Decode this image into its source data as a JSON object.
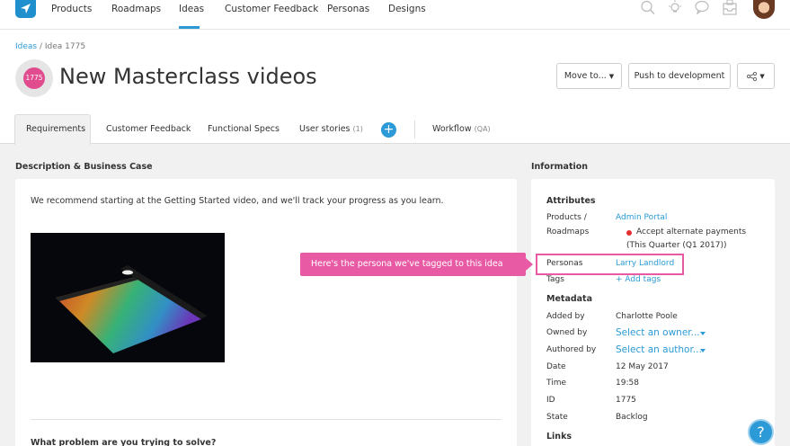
{
  "nav": {
    "items": [
      "Products",
      "Roadmaps",
      "Ideas",
      "Customer Feedback",
      "Personas",
      "Designs"
    ],
    "active": "Ideas",
    "icons": [
      "search-icon",
      "lightbulb-icon",
      "chat-icon",
      "inbox-icon"
    ]
  },
  "breadcrumb": {
    "root": "Ideas",
    "separator": "/",
    "current": "Idea 1775"
  },
  "idea": {
    "id_badge": "1775",
    "title": "New Masterclass videos"
  },
  "actions": {
    "move_label": "Move to...",
    "push_label": "Push to development"
  },
  "tabs": [
    {
      "label": "Requirements",
      "count": ""
    },
    {
      "label": "Customer Feedback",
      "count": ""
    },
    {
      "label": "Functional Specs",
      "count": ""
    },
    {
      "label": "User stories",
      "count": "(1)"
    },
    {
      "label": "Workflow",
      "count": "(QA)"
    }
  ],
  "description": {
    "section_title": "Description & Business Case",
    "text": "We recommend starting at the Getting Started video, and we'll track your progress as you learn.",
    "question": "What problem are you trying to solve?"
  },
  "information": {
    "section_title": "Information",
    "attributes_head": "Attributes",
    "products_label": "Products /",
    "roadmaps_label": "Roadmaps",
    "product_value": "Admin Portal",
    "release_value_1": "Accept alternate payments",
    "release_value_2": "(This Quarter (Q1 2017))",
    "personas_label": "Personas",
    "persona_value": "Larry Landlord",
    "tags_label": "Tags",
    "tags_value": "+ Add tags",
    "metadata_head": "Metadata",
    "added_by_label": "Added by",
    "added_by_value": "Charlotte Poole",
    "owned_by_label": "Owned by",
    "owned_by_value": "Select an owner...",
    "authored_by_label": "Authored by",
    "authored_by_value": "Select an author...",
    "date_label": "Date",
    "date_value": "12 May 2017",
    "time_label": "Time",
    "time_value": "19:58",
    "id_label": "ID",
    "id_value": "1775",
    "state_label": "State",
    "state_value": "Backlog",
    "links_head": "Links"
  },
  "callout": {
    "text": "Here's the persona we've tagged to this idea"
  },
  "help": {
    "label": "?"
  },
  "colors": {
    "accent": "#2b9ad6",
    "callout": "#e85aa4",
    "badge": "#e04c8e"
  }
}
